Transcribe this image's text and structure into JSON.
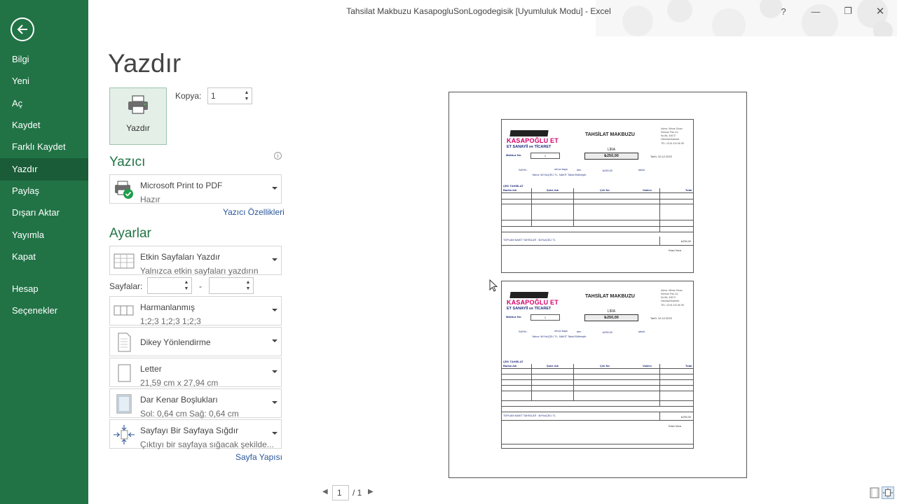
{
  "window": {
    "title": "Tahsilat Makbuzu KasapogluSonLogodegisik  [Uyumluluk Modu] - Excel",
    "help": "?",
    "minimize": "—",
    "restore": "❐",
    "close": "✕"
  },
  "nav": {
    "back_icon": "arrow-left-icon",
    "items": [
      {
        "label": "Bilgi"
      },
      {
        "label": "Yeni"
      },
      {
        "label": "Aç"
      },
      {
        "label": "Kaydet"
      },
      {
        "label": "Farklı Kaydet"
      },
      {
        "label": "Yazdır",
        "active": true
      },
      {
        "label": "Paylaş"
      },
      {
        "label": "Dışarı Aktar"
      },
      {
        "label": "Yayımla"
      },
      {
        "label": "Kapat"
      },
      {
        "label": "Hesap"
      },
      {
        "label": "Seçenekler"
      }
    ]
  },
  "print": {
    "heading": "Yazdır",
    "button_label": "Yazdır",
    "copies_label": "Kopya:",
    "copies_value": "1"
  },
  "printer": {
    "heading": "Yazıcı",
    "name": "Microsoft Print to PDF",
    "status": "Hazır",
    "properties_link": "Yazıcı Özellikleri"
  },
  "settings": {
    "heading": "Ayarlar",
    "print_what": {
      "line1": "Etkin Sayfaları Yazdır",
      "line2": "Yalnızca etkin sayfaları yazdırın"
    },
    "pages_label": "Sayfalar:",
    "pages_dash": "-",
    "collation": {
      "line1": "Harmanlanmış",
      "line2": "1;2;3    1;2;3    1;2;3"
    },
    "orientation": {
      "line1": "Dikey Yönlendirme"
    },
    "paper": {
      "line1": "Letter",
      "line2": "21,59 cm x 27,94 cm"
    },
    "margins": {
      "line1": "Dar Kenar Boşlukları",
      "line2": "Sol:  0,64 cm    Sağ:  0,64 cm"
    },
    "scaling": {
      "line1": "Sayfayı Bir Sayfaya Sığdır",
      "line2": "Çıktıyı bir sayfaya sığacak şekilde..."
    },
    "page_setup_link": "Sayfa Yapısı"
  },
  "receipt": {
    "logo_line": "KASAPOĞLU ET",
    "logo_sub": "ET SANAYİİ ve TİCARET",
    "title": "TAHSİLAT MAKBUZU",
    "address": [
      "Adres: Mimar Sinan",
      "Selman Pak Cd.",
      "No:8d, 34672",
      "Üsküdar/İstanbul",
      "TEL: 0216 410 66 98"
    ],
    "lira": "LİRA",
    "amount": "₺250,00",
    "makbuz_no_label": "Makbuz No:",
    "makbuz_no": "1",
    "tarih": "Tarih:  10.12.2022",
    "sayin": "SAYIN :",
    "name": "orhun kaya",
    "den": "den",
    "amount_small": "₺250,00",
    "tahsil": "tahsil.",
    "yalniz": "Yalnız: İkİYüzÇELİ TL. NAKİT Tahsil Edilmiştir.",
    "cek_tahsilat": "ÇEK TAHSİLAT",
    "cols": [
      "Banka Adı",
      "Şube Adı",
      "Çek No",
      "Vadesi",
      "Tutar"
    ],
    "toplam": "TOPLAM NAKİT TAHSİLATİ : İkİYüzÇELİ TL",
    "toplam_val": "₺250,00",
    "kasa": "Kasa İmza"
  },
  "pager": {
    "current": "1",
    "of": "/ 1"
  },
  "colors": {
    "accent": "#217346",
    "link": "#2b579a"
  }
}
